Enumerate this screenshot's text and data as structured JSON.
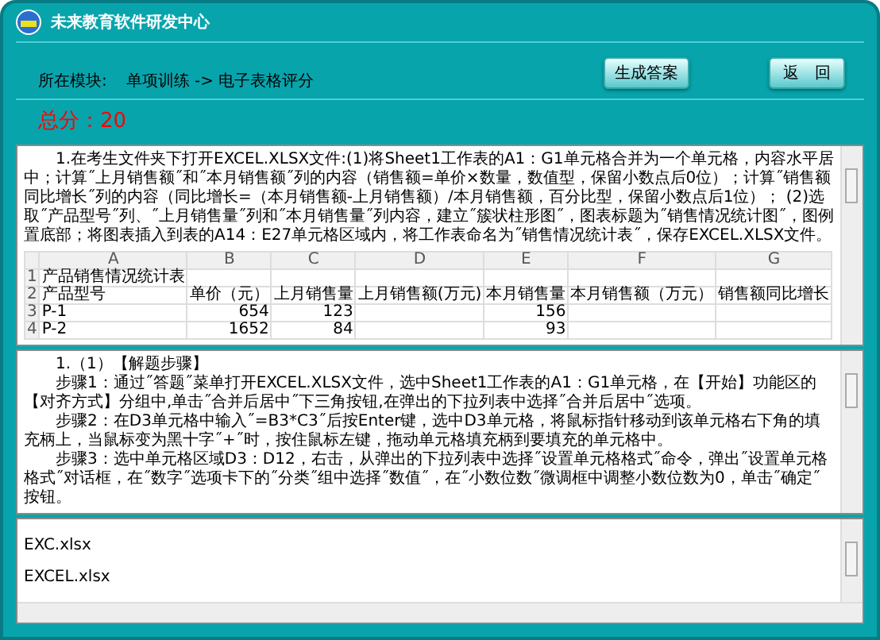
{
  "window": {
    "title": "未来教育软件研发中心"
  },
  "header": {
    "module_label": "所在模块:",
    "breadcrumb": "单项训练 -> 电子表格评分",
    "buttons": [
      "生成答案",
      "返　回"
    ]
  },
  "score": "总分：20",
  "question": {
    "text": "1.在考生文件夹下打开EXCEL.XLSX文件:(1)将Sheet1工作表的A1：G1单元格合并为一个单元格，内容水平居中；计算˝上月销售额˝和˝本月销售额˝列的内容（销售额=单价×数量，数值型，保留小数点后0位）；计算˝销售额同比增长˝列的内容（同比增长=（本月销售额-上月销售额）/本月销售额，百分比型，保留小数点后1位）； (2)选取˝产品型号˝列、˝上月销售量˝列和˝本月销售量˝列内容，建立˝簇状柱形图˝，图表标题为˝销售情况统计图˝，图例置底部；将图表插入到表的A14：E27单元格区域内，将工作表命名为˝销售情况统计表˝，保存EXCEL.XLSX文件。",
    "sheet": {
      "columns": [
        "A",
        "B",
        "C",
        "D",
        "E",
        "F",
        "G"
      ],
      "row_numbers": [
        "1",
        "2",
        "3",
        "4"
      ],
      "rows": [
        [
          "产品销售情况统计表",
          "",
          "",
          "",
          "",
          "",
          ""
        ],
        [
          "产品型号",
          "单价（元）",
          "上月销售量",
          "上月销售额(万元)",
          "本月销售量",
          "本月销售额（万元）",
          "销售额同比增长"
        ],
        [
          "P-1",
          "654",
          "123",
          "",
          "156",
          "",
          ""
        ],
        [
          "P-2",
          "1652",
          "84",
          "",
          "93",
          "",
          ""
        ]
      ]
    }
  },
  "answer": [
    "1.（1）【解题步骤】",
    "步骤1：通过˝答题˝菜单打开EXCEL.XLSX文件，选中Sheet1工作表的A1：G1单元格，在【开始】功能区的【对齐方式】分组中,单击˝合并后居中˝下三角按钮,在弹出的下拉列表中选择˝合并后居中˝选项。",
    "步骤2：在D3单元格中输入˝=B3*C3˝后按Enter键，选中D3单元格，将鼠标指针移动到该单元格右下角的填充柄上，当鼠标变为黑十字˝+˝时，按住鼠标左键，拖动单元格填充柄到要填充的单元格中。",
    "步骤3：选中单元格区域D3：D12，右击，从弹出的下拉列表中选择˝设置单元格格式˝命令，弹出˝设置单元格格式˝对话框，在˝数字˝选项卡下的˝分类˝组中选择˝数值˝，在˝小数位数˝微调框中调整小数位数为0，单击˝确定˝按钮。"
  ],
  "files": [
    "EXC.xlsx",
    "EXCEL.xlsx"
  ]
}
